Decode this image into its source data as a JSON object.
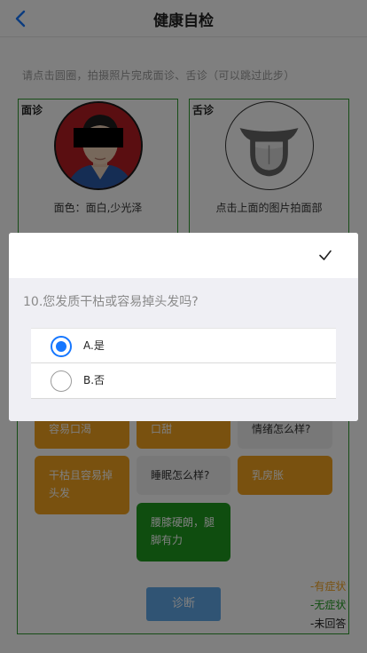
{
  "header": {
    "title": "健康自检",
    "back_icon": "chevron-left-icon"
  },
  "hint": "请点击圆圈，拍摄照片完成面诊、舌诊（可以跳过此步）",
  "face_card": {
    "tag": "面诊",
    "caption": "面色：面白,少光泽"
  },
  "tongue_card": {
    "tag": "舌诊",
    "caption": "点击上面的图片拍面部"
  },
  "symptoms": {
    "items": [
      {
        "label": "容易口渴",
        "state": "有症状"
      },
      {
        "label": "口甜",
        "state": "有症状"
      },
      {
        "label": "情绪怎么样?",
        "state": "未回答"
      },
      {
        "label": "干枯且容易掉头发",
        "state": "有症状"
      },
      {
        "label": "睡眠怎么样?",
        "state": "未回答"
      },
      {
        "label": "乳房胀",
        "state": "有症状"
      },
      {
        "label": "腰膝硬朗，腿脚有力",
        "state": "无症状"
      }
    ]
  },
  "diagnose_button": "诊断",
  "legend": {
    "has": "-有症状",
    "none": "-无症状",
    "unanswered": "-未回答"
  },
  "colors": {
    "has": "#f3a31f",
    "none": "#1f9a1f",
    "unanswered": "#f0f0f0",
    "accent": "#1677ff"
  },
  "dialog": {
    "confirm_icon": "check-icon",
    "question": "10.您发质干枯或容易掉头发吗?",
    "options": [
      {
        "label": "A.是",
        "selected": true
      },
      {
        "label": "B.否",
        "selected": false
      }
    ]
  }
}
